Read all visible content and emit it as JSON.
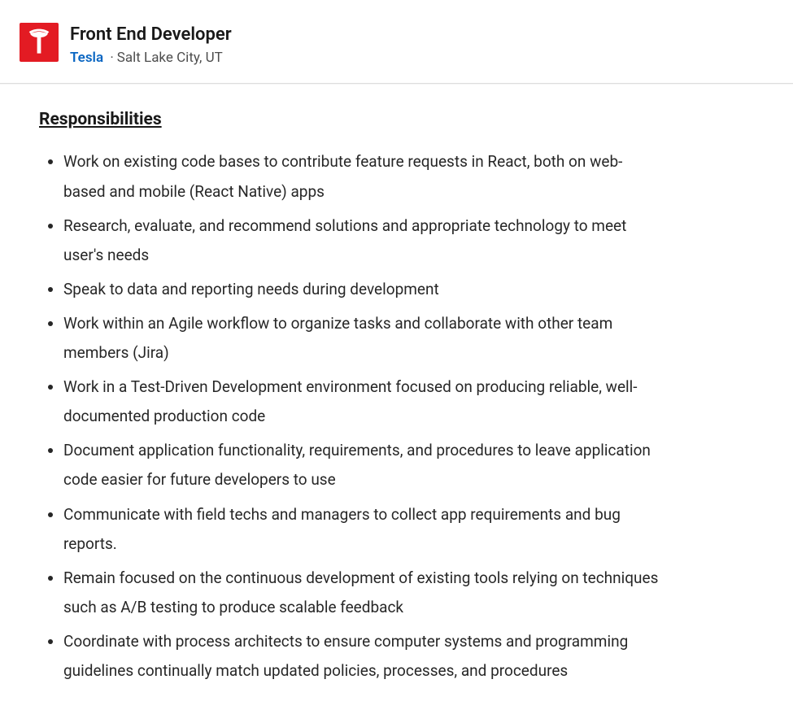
{
  "header": {
    "logo_name": "tesla-logo",
    "job_title": "Front End Developer",
    "company": "Tesla",
    "separator": "·",
    "location": "Salt Lake City, UT"
  },
  "section": {
    "heading": "Responsibilities",
    "items": [
      "Work on existing code bases to contribute feature requests in React, both on web-based and mobile (React Native) apps",
      "Research, evaluate, and recommend solutions and appropriate technology to meet user's needs",
      "Speak to data and reporting needs during development",
      "Work within an Agile workflow to organize tasks and collaborate with other team members (Jira)",
      "Work in a Test-Driven Development environment focused on producing reliable, well-documented production code",
      "Document application functionality, requirements, and procedures to leave application code easier for future developers to use",
      "Communicate with field techs and managers to collect app requirements and bug reports.",
      "Remain focused on the continuous development of existing tools relying on techniques such as A/B testing to produce scalable feedback",
      "Coordinate with process architects to ensure computer systems and programming guidelines continually match updated policies, processes, and procedures"
    ]
  }
}
